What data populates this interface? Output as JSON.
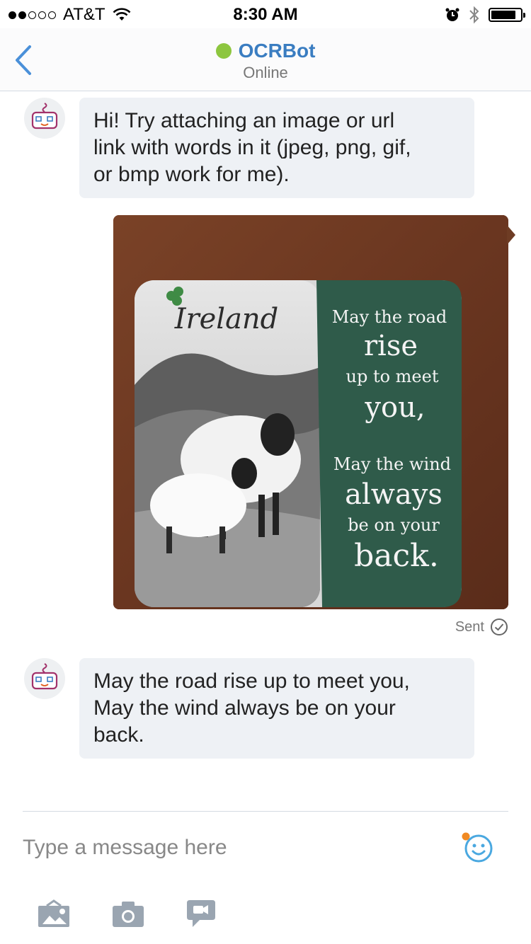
{
  "status_bar": {
    "carrier": "AT&T",
    "time": "8:30 AM",
    "signal_bars": 2,
    "signal_total": 5,
    "battery_level": 0.85
  },
  "header": {
    "contact_name": "OCRBot",
    "contact_status": "Online",
    "presence_color": "#8dc63f"
  },
  "messages": {
    "bot_greeting": [
      "Hi!  Try attaching an image or url",
      "link with words in it (jpeg, png, gif,",
      "or bmp work for me)."
    ],
    "photo": {
      "coaster_title": "Ireland",
      "coaster_lines": [
        "May the road",
        "rise",
        "up to meet",
        "you,",
        "May the wind",
        "always",
        "be on your",
        "back."
      ]
    },
    "sent_label": "Sent",
    "bot_reply": [
      "May the road rise up to meet you,",
      "May the wind always be on your",
      "back."
    ]
  },
  "composer": {
    "placeholder": "Type a message here"
  },
  "icons": [
    "back-chevron-icon",
    "emoji-icon",
    "image-gallery-icon",
    "camera-icon",
    "video-message-icon"
  ],
  "colors": {
    "accent": "#3a7dc1",
    "bubble": "#eef1f5",
    "icon_gray": "#9aa5b1",
    "emoji_blue": "#4aa8e0",
    "notification_dot": "#f08a24"
  }
}
